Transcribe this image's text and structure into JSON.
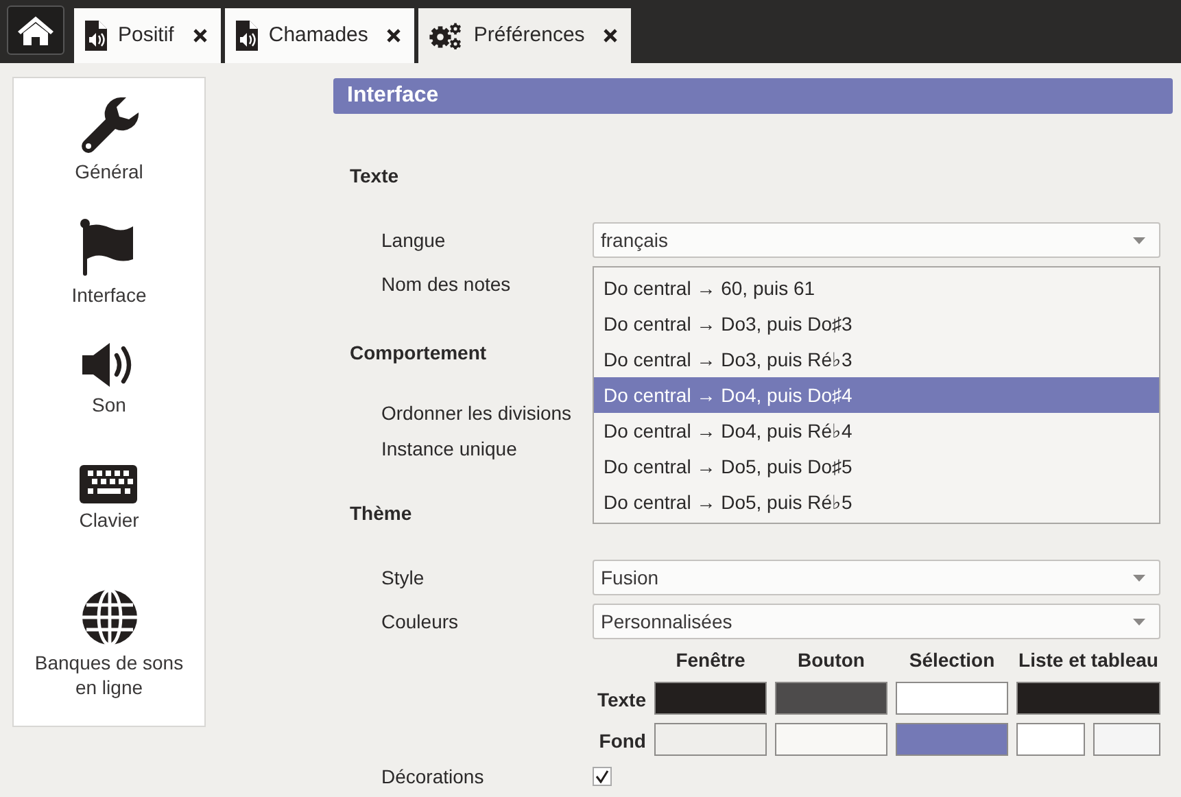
{
  "tabs": [
    {
      "label": "Positif",
      "kind": "document",
      "selected": false
    },
    {
      "label": "Chamades",
      "kind": "document",
      "selected": false
    },
    {
      "label": "Préférences",
      "kind": "settings",
      "selected": true
    }
  ],
  "sidebar": {
    "items": [
      {
        "label": "Général",
        "kind": "wrench"
      },
      {
        "label": "Interface",
        "kind": "flag"
      },
      {
        "label": "Son",
        "kind": "speaker"
      },
      {
        "label": "Clavier",
        "kind": "keyboard"
      },
      {
        "label": "Banques de sons en ligne",
        "kind": "globe"
      }
    ]
  },
  "panel": {
    "title": "Interface",
    "sections": [
      {
        "title": "Texte",
        "rows": [
          {
            "label": "Langue",
            "kind": "combo",
            "value": "français"
          },
          {
            "label": "Nom des notes",
            "kind": "popup",
            "options": [
              {
                "label": "Do central → 60, puis 61",
                "selected": false
              },
              {
                "label": "Do central → Do3, puis Do♯3",
                "selected": false
              },
              {
                "label": "Do central → Do3, puis Ré♭3",
                "selected": false
              },
              {
                "label": "Do central → Do4, puis Do♯4",
                "selected": true
              },
              {
                "label": "Do central → Do4, puis Ré♭4",
                "selected": false
              },
              {
                "label": "Do central → Do5, puis Do♯5",
                "selected": false
              },
              {
                "label": "Do central → Do5, puis Ré♭5",
                "selected": false
              }
            ]
          }
        ]
      },
      {
        "title": "Comportement",
        "rows": [
          {
            "label": "Ordonner les divisions",
            "kind": "label"
          },
          {
            "label": "Instance unique",
            "kind": "label"
          }
        ]
      },
      {
        "title": "Thème",
        "rows": [
          {
            "label": "Style",
            "kind": "combo",
            "value": "Fusion"
          },
          {
            "label": "Couleurs",
            "kind": "combo",
            "value": "Personnalisées"
          },
          {
            "kind": "colors",
            "columns": [
              "Fenêtre",
              "Bouton",
              "Sélection",
              "Liste et tableau"
            ],
            "rows": [
              {
                "label": "Texte",
                "cells": [
                  {
                    "swatches": [
                      {
                        "color": "#231f1e"
                      }
                    ]
                  },
                  {
                    "swatches": [
                      {
                        "color": "#4d4b4b"
                      }
                    ]
                  },
                  {
                    "swatches": [
                      {
                        "color": "#ffffff"
                      }
                    ]
                  },
                  {
                    "swatches": [
                      {
                        "color": "#231f1e"
                      }
                    ]
                  }
                ]
              },
              {
                "label": "Fond",
                "cells": [
                  {
                    "swatches": [
                      {
                        "color": "#efeeeb"
                      }
                    ]
                  },
                  {
                    "swatches": [
                      {
                        "color": "#f9f8f5"
                      }
                    ]
                  },
                  {
                    "swatches": [
                      {
                        "color": "#7479b6"
                      }
                    ]
                  },
                  {
                    "swatches": [
                      {
                        "color": "#ffffff"
                      },
                      {
                        "color": "#f5f5f5"
                      }
                    ]
                  }
                ]
              }
            ]
          },
          {
            "label": "Décorations",
            "kind": "checkbox",
            "checked": true
          }
        ]
      }
    ]
  }
}
